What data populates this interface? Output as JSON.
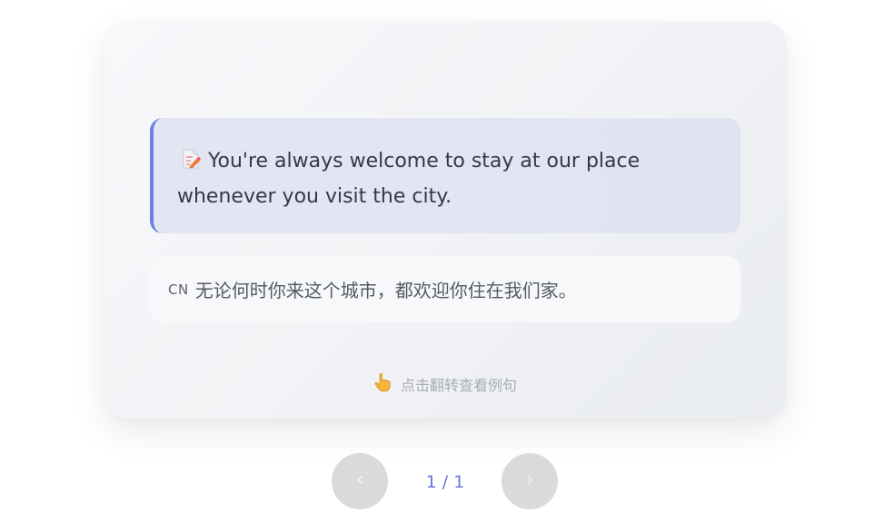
{
  "card": {
    "sentence": "You're always welcome to stay at our place whenever you visit the city.",
    "sentence_icon": "memo-icon",
    "translation_tag": "CN",
    "translation": "无论何时你来这个城市，都欢迎你住在我们家。",
    "hint": "点击翻转查看例句",
    "hint_icon": "pointing-hand-icon"
  },
  "pagination": {
    "prev_label": "‹",
    "next_label": "›",
    "counter": "1 / 1"
  },
  "colors": {
    "accent": "#6d7fe0",
    "counter": "#6a78d2",
    "nav_button": "#dadada"
  }
}
